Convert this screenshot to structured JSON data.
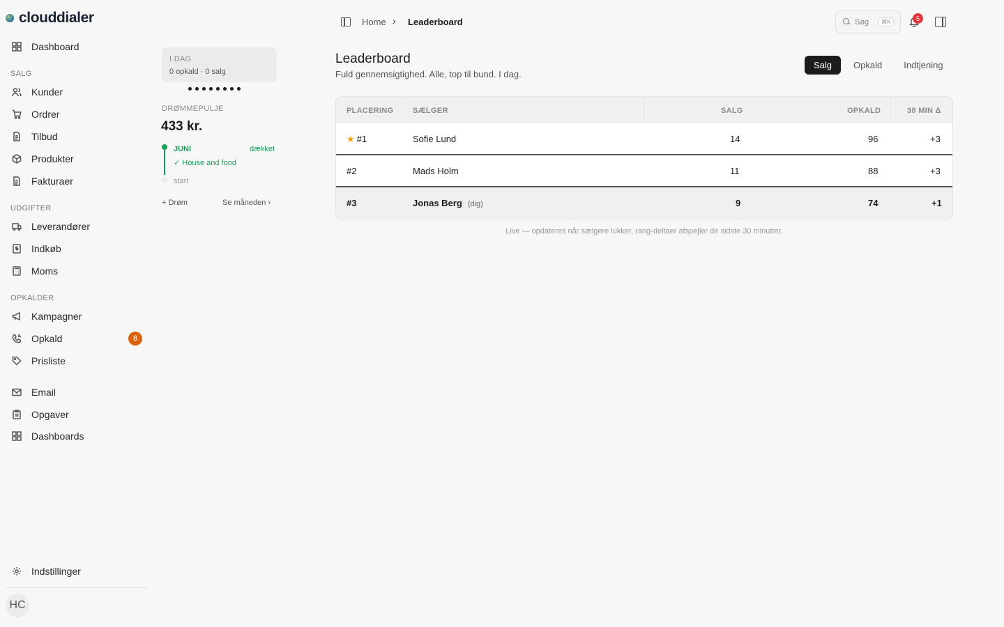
{
  "brand": {
    "name": "clouddialer"
  },
  "sidebar": {
    "dashboard": "Dashboard",
    "sections": {
      "salg": "SALG",
      "udgifter": "UDGIFTER",
      "opkalder": "OPKALDER"
    },
    "salg_items": [
      "Kunder",
      "Ordrer",
      "Tilbud",
      "Produkter",
      "Fakturaer"
    ],
    "udgifter_items": [
      "Leverandører",
      "Indkøb",
      "Moms"
    ],
    "opkalder_items": [
      "Kampagner",
      "Opkald",
      "Prisliste"
    ],
    "opkald_badge": "8",
    "extra_items": [
      "Email",
      "Opgaver",
      "Dashboards"
    ],
    "settings": "Indstillinger",
    "avatar_initials": "HC"
  },
  "panel": {
    "today_title": "I DAG",
    "today_sub": "0 opkald · 0 salg",
    "pool_label": "DRØMMEPULJE",
    "pool_amount": "433 kr.",
    "month": "JUNI",
    "covered": "dækket",
    "goal": "✓ House and food",
    "start": "start",
    "add_dream": "+ Drøm",
    "see_month": "Se måneden ›"
  },
  "topbar": {
    "breadcrumb_home": "Home",
    "breadcrumb_sep": "›",
    "breadcrumb_current": "Leaderboard",
    "search_placeholder": "Søg",
    "search_shortcut": "⌘K",
    "notifications_count": "5"
  },
  "main": {
    "title": "Leaderboard",
    "subtitle": "Fuld gennemsigtighed. Alle, top til bund. I dag.",
    "tabs": [
      "Salg",
      "Opkald",
      "Indtjening"
    ],
    "active_tab": "Salg",
    "columns": [
      "PLACERING",
      "SÆLGER",
      "SALG",
      "OPKALD",
      "30 MIN Δ"
    ],
    "rows": [
      {
        "rank": "#1",
        "name": "Sofie Lund",
        "tag": "",
        "sales": "14",
        "calls": "96",
        "delta": "+3"
      },
      {
        "rank": "#2",
        "name": "Mads Holm",
        "tag": "",
        "sales": "11",
        "calls": "88",
        "delta": "+3"
      },
      {
        "rank": "#3",
        "name": "Jonas Berg",
        "tag": "(dig)",
        "sales": "9",
        "calls": "74",
        "delta": "+1"
      }
    ],
    "footnote": "Live — opdateres når sælgere lukker, rang-deltaer afspejler de sidste 30 minutter."
  },
  "colors": {
    "accent_green": "#18a05a",
    "badge_orange": "#d9630e",
    "notification_red": "#e5383b",
    "star": "#f2a20c"
  }
}
